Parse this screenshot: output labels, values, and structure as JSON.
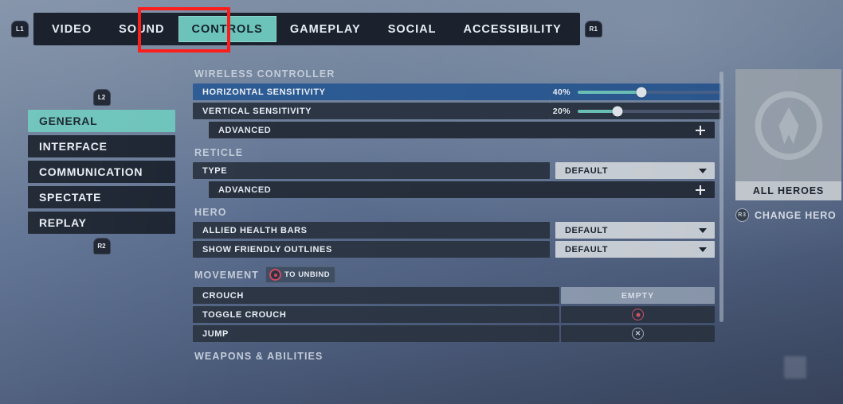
{
  "topbar": {
    "left_bumper": "L1",
    "right_bumper": "R1",
    "tabs": [
      {
        "label": "VIDEO",
        "active": false
      },
      {
        "label": "SOUND",
        "active": false
      },
      {
        "label": "CONTROLS",
        "active": true
      },
      {
        "label": "GAMEPLAY",
        "active": false
      },
      {
        "label": "SOCIAL",
        "active": false
      },
      {
        "label": "ACCESSIBILITY",
        "active": false
      }
    ]
  },
  "sidebar": {
    "top_trigger": "L2",
    "bottom_trigger": "R2",
    "items": [
      {
        "label": "GENERAL",
        "active": true
      },
      {
        "label": "INTERFACE",
        "active": false
      },
      {
        "label": "COMMUNICATION",
        "active": false
      },
      {
        "label": "SPECTATE",
        "active": false
      },
      {
        "label": "REPLAY",
        "active": false
      }
    ]
  },
  "settings": {
    "sections": [
      {
        "title": "WIRELESS CONTROLLER",
        "hint": null,
        "rows": [
          {
            "kind": "slider",
            "label": "HORIZONTAL SENSITIVITY",
            "value": "40%",
            "percent": 45,
            "focused": true
          },
          {
            "kind": "slider",
            "label": "VERTICAL SENSITIVITY",
            "value": "20%",
            "percent": 28,
            "focused": false
          },
          {
            "kind": "advanced",
            "label": "ADVANCED",
            "icon": "plus-icon"
          }
        ]
      },
      {
        "title": "RETICLE",
        "hint": null,
        "rows": [
          {
            "kind": "dropdown",
            "label": "TYPE",
            "value": "DEFAULT"
          },
          {
            "kind": "advanced",
            "label": "ADVANCED",
            "icon": "plus-icon"
          }
        ]
      },
      {
        "title": "HERO",
        "hint": null,
        "rows": [
          {
            "kind": "dropdown",
            "label": "ALLIED HEALTH BARS",
            "value": "DEFAULT"
          },
          {
            "kind": "dropdown",
            "label": "SHOW FRIENDLY OUTLINES",
            "value": "DEFAULT"
          }
        ]
      },
      {
        "title": "MOVEMENT",
        "hint": "TO UNBIND",
        "rows": [
          {
            "kind": "bind",
            "label": "CROUCH",
            "value": "EMPTY",
            "glyph": null
          },
          {
            "kind": "bind",
            "label": "TOGGLE CROUCH",
            "value": "",
            "glyph": "ps-circle-icon"
          },
          {
            "kind": "bind",
            "label": "JUMP",
            "value": "",
            "glyph": "ps-cross-icon"
          }
        ]
      },
      {
        "title": "WEAPONS & ABILITIES",
        "hint": null,
        "rows": []
      }
    ]
  },
  "hero_panel": {
    "portrait_icon": "overwatch-logo-icon",
    "name": "ALL HEROES",
    "change_button": "R3",
    "change_label": "CHANGE HERO"
  },
  "annotation": {
    "color": "#fc1d1d",
    "target": "CONTROLS"
  },
  "colors": {
    "accent_teal": "#6cc3ba",
    "focus_blue": "#2c5a93",
    "row_dark": "#2c3645",
    "annotation_red": "#fc1d1d"
  }
}
